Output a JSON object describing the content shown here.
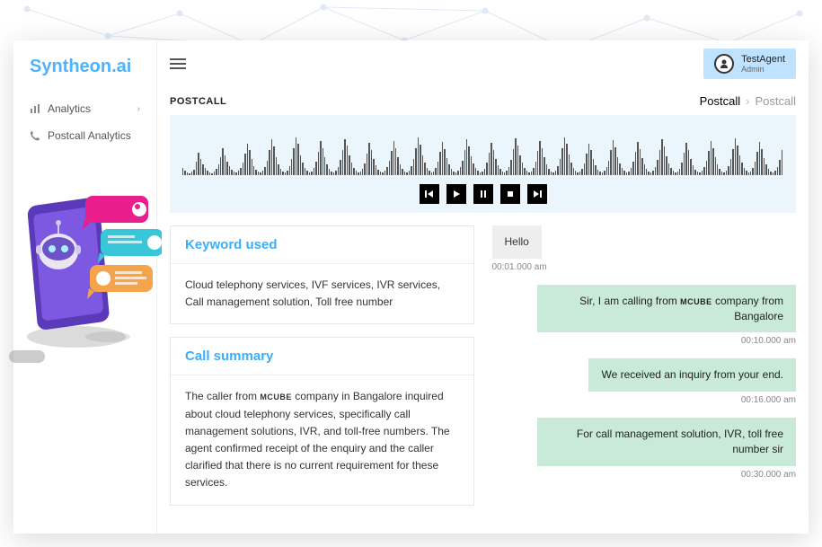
{
  "brand": "Syntheon.ai",
  "nav": {
    "items": [
      {
        "label": "Analytics",
        "icon": "bars",
        "has_children": true
      },
      {
        "label": "Postcall Analytics",
        "icon": "phone",
        "has_children": false
      }
    ]
  },
  "user": {
    "name": "TestAgent",
    "role": "Admin"
  },
  "page": {
    "title": "POSTCALL"
  },
  "breadcrumb": {
    "current": "Postcall",
    "child": "Postcall"
  },
  "player": {
    "buttons": [
      "prev",
      "play",
      "pause",
      "stop",
      "next"
    ]
  },
  "keyword_card": {
    "title": "Keyword used",
    "body": "Cloud telephony services, IVF services, IVR services, Call management solution, Toll free number"
  },
  "summary_card": {
    "title": "Call summary",
    "body_pre": "The caller from ",
    "body_brand": "MCUBE",
    "body_post": " company in Bangalore inquired about cloud telephony services, specifically call management solutions, IVR, and toll-free numbers. The agent confirmed receipt of the enquiry and the caller clarified that there is no current requirement for these services."
  },
  "chat": [
    {
      "side": "left",
      "style": "grey",
      "text": "Hello",
      "time": "00:01.000 am"
    },
    {
      "side": "right",
      "style": "mint",
      "text_pre": "Sir, I am calling from ",
      "brand": "MCUBE",
      "text_post": " company from Bangalore",
      "time": "00:10.000 am"
    },
    {
      "side": "right",
      "style": "mint",
      "text": "We received an inquiry from your end.",
      "time": "00:16.000 am"
    },
    {
      "side": "right",
      "style": "mint",
      "text": "For call management solution, IVR, toll free number sir",
      "time": "00:30.000 am"
    }
  ]
}
